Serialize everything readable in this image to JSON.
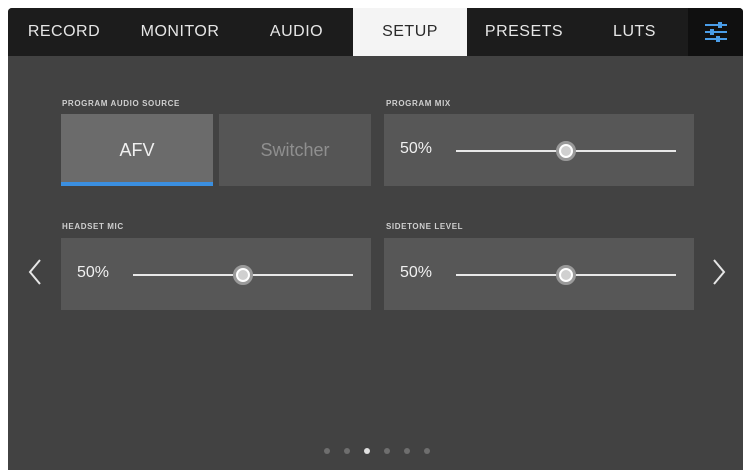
{
  "tabs": [
    {
      "label": "RECORD",
      "active": false
    },
    {
      "label": "MONITOR",
      "active": false
    },
    {
      "label": "AUDIO",
      "active": false
    },
    {
      "label": "SETUP",
      "active": true
    },
    {
      "label": "PRESETS",
      "active": false
    },
    {
      "label": "LUTS",
      "active": false
    }
  ],
  "settings_icon": "sliders-icon",
  "program_audio_source": {
    "label": "PROGRAM AUDIO SOURCE",
    "options": [
      "AFV",
      "Switcher"
    ],
    "selected": "AFV"
  },
  "program_mix": {
    "label": "PROGRAM MIX",
    "value_text": "50%",
    "level": 0.5
  },
  "headset_mic": {
    "label": "HEADSET MIC",
    "value_text": "50%",
    "level": 0.5
  },
  "sidetone_level": {
    "label": "SIDETONE LEVEL",
    "value_text": "50%",
    "level": 0.5
  },
  "pager": {
    "total": 6,
    "current_index": 2
  },
  "colors": {
    "accent": "#3b8fe0",
    "tab_active_bg": "#f4f4f4",
    "tabbar_bg": "#1c1c1c"
  }
}
